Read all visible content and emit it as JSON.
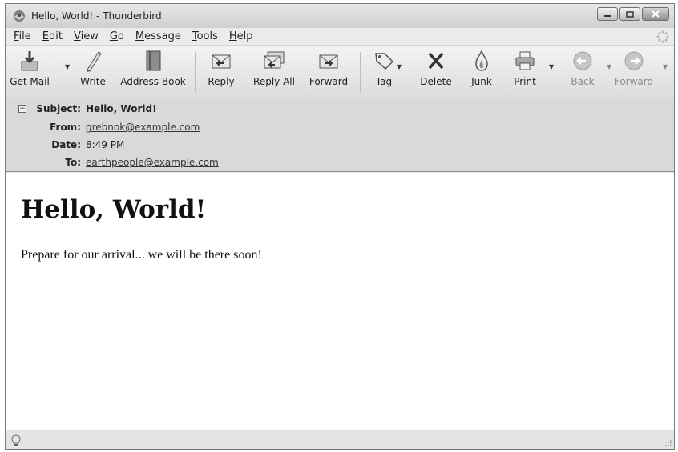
{
  "window": {
    "title": "Hello, World! - Thunderbird"
  },
  "menubar": {
    "items": [
      {
        "label": "File",
        "accel": "F"
      },
      {
        "label": "Edit",
        "accel": "E"
      },
      {
        "label": "View",
        "accel": "V"
      },
      {
        "label": "Go",
        "accel": "G"
      },
      {
        "label": "Message",
        "accel": "M"
      },
      {
        "label": "Tools",
        "accel": "T"
      },
      {
        "label": "Help",
        "accel": "H"
      }
    ]
  },
  "toolbar": {
    "buttons": [
      {
        "label": "Get Mail",
        "icon": "get-mail-icon",
        "has_dropdown": true,
        "enabled": true
      },
      {
        "label": "Write",
        "icon": "write-icon",
        "has_dropdown": false,
        "enabled": true
      },
      {
        "label": "Address Book",
        "icon": "address-book-icon",
        "has_dropdown": false,
        "enabled": true
      },
      {
        "label": "Reply",
        "icon": "reply-icon",
        "has_dropdown": false,
        "enabled": true
      },
      {
        "label": "Reply All",
        "icon": "reply-all-icon",
        "has_dropdown": false,
        "enabled": true
      },
      {
        "label": "Forward",
        "icon": "forward-mail-icon",
        "has_dropdown": false,
        "enabled": true
      },
      {
        "label": "Tag",
        "icon": "tag-icon",
        "has_dropdown": true,
        "enabled": true
      },
      {
        "label": "Delete",
        "icon": "delete-icon",
        "has_dropdown": false,
        "enabled": true
      },
      {
        "label": "Junk",
        "icon": "junk-icon",
        "has_dropdown": false,
        "enabled": true
      },
      {
        "label": "Print",
        "icon": "print-icon",
        "has_dropdown": true,
        "enabled": true
      },
      {
        "label": "Back",
        "icon": "back-arrow-icon",
        "has_dropdown": true,
        "enabled": false
      },
      {
        "label": "Forward",
        "icon": "forward-arrow-icon",
        "has_dropdown": true,
        "enabled": false
      }
    ]
  },
  "headers": {
    "subject_label": "Subject:",
    "subject_value": "Hello, World!",
    "from_label": "From:",
    "from_value": "grebnok@example.com",
    "date_label": "Date:",
    "date_value": "8:49 PM",
    "to_label": "To:",
    "to_value": "earthpeople@example.com"
  },
  "message": {
    "heading": "Hello, World!",
    "body": "Prepare for our arrival... we will be there soon!"
  },
  "colors": {
    "toolbar_bg": "#e6e6e6",
    "header_bg": "#d9d9d9",
    "body_bg": "#ffffff"
  }
}
